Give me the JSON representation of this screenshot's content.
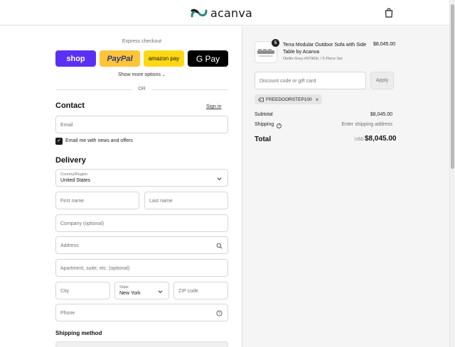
{
  "header": {
    "brand": "acanva"
  },
  "express": {
    "label": "Express checkout",
    "shop": "shop",
    "paypal": "PayPal",
    "amazon": "amazon pay",
    "gpay": "G Pay",
    "more_options": "Show more options",
    "or": "OR"
  },
  "contact": {
    "title": "Contact",
    "signin": "Sign in",
    "email_placeholder": "Email",
    "news_label": "Email me with news and offers"
  },
  "delivery": {
    "title": "Delivery",
    "country_label": "Country/Region",
    "country_value": "United States",
    "first_name": "First name",
    "last_name": "Last name",
    "company": "Company (optional)",
    "address": "Address",
    "apartment": "Apartment, suite, etc. (optional)",
    "city": "City",
    "state_label": "State",
    "state_value": "New York",
    "zip": "ZIP code",
    "phone": "Phone"
  },
  "shipping": {
    "title": "Shipping method"
  },
  "summary": {
    "quantity": "5",
    "product_name": "Terra Modular Outdoor Sofa with Side Table by Acanva",
    "product_variant": "Olefin-Grey-#97969c / 5 Piece Set",
    "product_price": "$8,045.00",
    "discount_placeholder": "Discount code or gift card",
    "apply": "Apply",
    "discount_tag": "FREEDOORSTEP100",
    "subtotal_label": "Subtotal",
    "subtotal_value": "$8,045.00",
    "shipping_label": "Shipping",
    "shipping_value": "Enter shipping address",
    "total_label": "Total",
    "currency": "USD",
    "total_value": "$8,045.00"
  },
  "colors": {
    "brand_teal": "#2a8a7a",
    "shop_purple": "#5a31f4",
    "paypal_yellow": "#ffc439",
    "amazon_yellow": "#ffd814"
  }
}
